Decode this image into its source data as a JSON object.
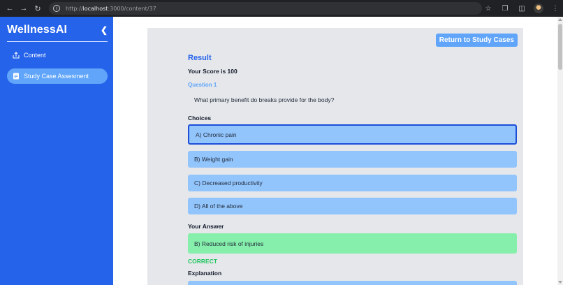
{
  "browser": {
    "url_prefix": "http://",
    "url_host": "localhost",
    "url_path": ":3000/content/37",
    "icons": [
      "back-arrow-icon",
      "forward-arrow-icon",
      "reload-icon",
      "site-info-icon",
      "star-icon",
      "extensions-icon",
      "sidepanel-icon",
      "profile-avatar",
      "menu-dots-icon"
    ]
  },
  "sidebar": {
    "brand": "WellnessAI",
    "items": [
      {
        "label": "Content",
        "icon": "upload-box-icon"
      },
      {
        "label": "Study Case Assesment",
        "icon": "document-icon",
        "active": true
      }
    ]
  },
  "main": {
    "return_button": "Return to Study Cases",
    "result_title": "Result",
    "score": "Your Score is 100",
    "question_label": "Question 1",
    "question_text": "What primary benefit do breaks provide for the body?",
    "choices_label": "Choices",
    "choices": [
      "A) Chronic pain",
      "B) Weight gain",
      "C) Decreased productivity",
      "D) All of the above"
    ],
    "answer_label": "Your Answer",
    "answer": "B) Reduced risk of injuries",
    "status": "CORRECT",
    "explanation_label": "Explanation"
  },
  "colors": {
    "sidebar_bg": "#2563eb",
    "active_item": "#60a5fa",
    "choice_bg": "#93c5fd",
    "answer_bg": "#86efac",
    "correct_text": "#22c55e",
    "card_bg": "#e5e7eb"
  }
}
